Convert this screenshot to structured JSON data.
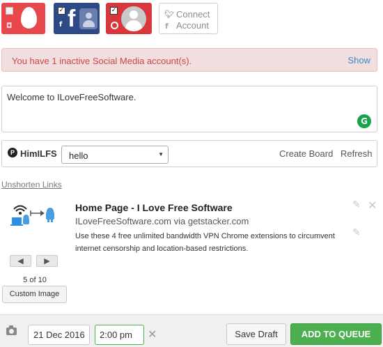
{
  "accounts": [
    {
      "network": "instagram",
      "icon": "egg-avatar-icon",
      "selected": false,
      "color": "#e8474c"
    },
    {
      "network": "facebook",
      "icon": "facebook-group-avatar-icon",
      "selected": true,
      "color": "#2d4a86"
    },
    {
      "network": "google-plus",
      "icon": "person-avatar-icon",
      "selected": true,
      "color": "#d8383d"
    }
  ],
  "connect": {
    "line1": "Connect",
    "line2": "Account"
  },
  "alert": {
    "message": "You have 1 inactive Social Media account(s).",
    "action": "Show"
  },
  "composer": {
    "text": "Welcome to ILoveFreeSoftware."
  },
  "pinterest": {
    "username": "HimILFS",
    "board": "hello",
    "create_board": "Create Board",
    "refresh": "Refresh"
  },
  "unshorten": "Unshorten Links",
  "preview": {
    "title": "Home Page - I Love Free Software",
    "source": "ILoveFreeSoftware.com via getstacker.com",
    "description": "Use these 4 free unlimited bandwidth VPN Chrome extensions to circumvent internet censorship and location-based restrictions.",
    "image_counter": "5 of 10",
    "custom_image": "Custom Image"
  },
  "schedule": {
    "date": "21 Dec 2016",
    "time": "2:00 pm",
    "save_draft": "Save Draft",
    "add_to_queue": "ADD TO QUEUE"
  },
  "colors": {
    "accent_green": "#4caf50",
    "alert_bg": "#f2dede",
    "alert_text": "#c8474a",
    "link_blue": "#3a87c9"
  }
}
